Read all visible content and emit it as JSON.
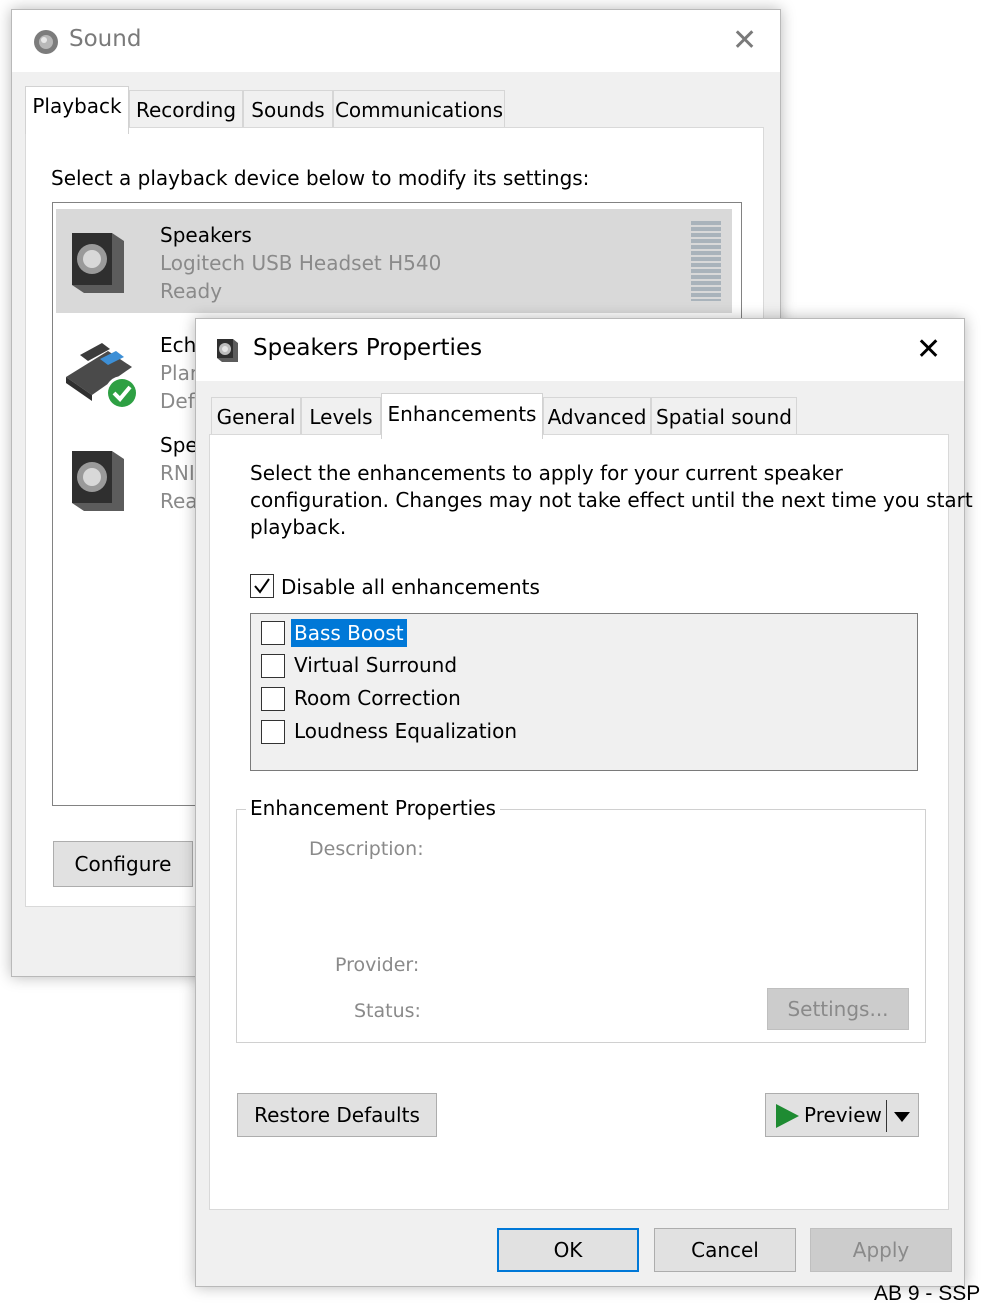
{
  "sound_window": {
    "title": "Sound",
    "tabs": [
      "Playback",
      "Recording",
      "Sounds",
      "Communications"
    ],
    "instruction": "Select a playback device below to modify its settings:",
    "devices": [
      {
        "name": "Speakers",
        "device": "Logitech USB Headset H540",
        "status": "Ready"
      },
      {
        "name": "Ech",
        "device": "Plan",
        "status": "Def"
      },
      {
        "name": "Spe",
        "device": "RNI",
        "status": "Rea"
      }
    ],
    "configure_label": "Configure"
  },
  "props_window": {
    "title": "Speakers Properties",
    "tabs": [
      "General",
      "Levels",
      "Enhancements",
      "Advanced",
      "Spatial sound"
    ],
    "active_tab": "Enhancements",
    "intro_lines": [
      "Select the enhancements to apply for your current speaker",
      "configuration. Changes may not take effect until the next time you start",
      "playback."
    ],
    "disable_all": {
      "label": "Disable all enhancements",
      "checked": true
    },
    "enhancements": [
      {
        "label": "Bass Boost",
        "checked": false,
        "selected": true
      },
      {
        "label": "Virtual Surround",
        "checked": false
      },
      {
        "label": "Room Correction",
        "checked": false
      },
      {
        "label": "Loudness Equalization",
        "checked": false
      }
    ],
    "properties": {
      "group_label": "Enhancement Properties",
      "description_label": "Description:",
      "provider_label": "Provider:",
      "status_label": "Status:",
      "settings_label": "Settings..."
    },
    "restore_defaults_label": "Restore Defaults",
    "preview_label": "Preview",
    "ok_label": "OK",
    "cancel_label": "Cancel",
    "apply_label": "Apply"
  },
  "footer_text": "AB 9 - SSP",
  "colors": {
    "selection": "#0078d7",
    "accent": "#0078d7",
    "success": "#2ea043"
  }
}
